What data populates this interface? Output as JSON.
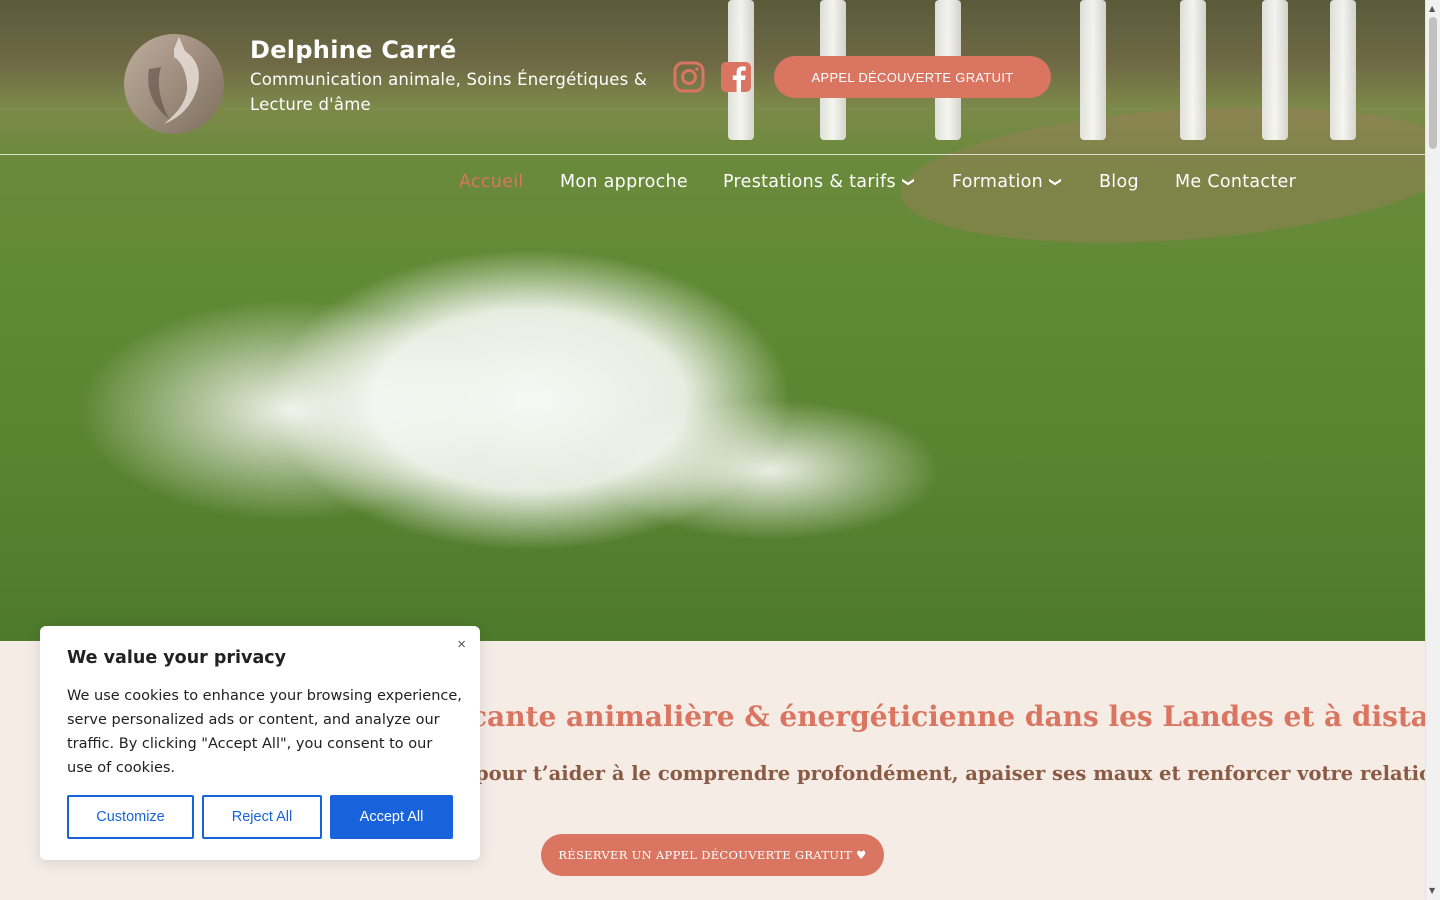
{
  "brand": {
    "name": "Delphine Carré",
    "tagline": "Communication animale, Soins Énergétiques & Lecture d'âme",
    "accent_color": "#d97560",
    "logo_icon": "cat-moon-logo"
  },
  "header": {
    "social": [
      {
        "name": "instagram-icon"
      },
      {
        "name": "facebook-icon"
      }
    ],
    "cta_label": "APPEL DÉCOUVERTE GRATUIT"
  },
  "nav": {
    "items": [
      {
        "label": "Accueil",
        "active": true
      },
      {
        "label": "Mon approche"
      },
      {
        "label": "Prestations & tarifs",
        "dropdown": true
      },
      {
        "label": "Formation",
        "dropdown": true
      },
      {
        "label": "Blog"
      },
      {
        "label": "Me Contacter"
      }
    ]
  },
  "content": {
    "headline_visible": "cante animalière & énergéticienne dans les Landes et à distance",
    "subline_visible": "pour t’aider à le comprendre profondément, apaiser ses maux et renforcer votre relation.",
    "cta_label": "RÉSERVER UN APPEL DÉCOUVERTE GRATUIT ♥"
  },
  "cookie_banner": {
    "title": "We value your privacy",
    "body": "We use cookies to enhance your browsing experience, serve personalized ads or content, and analyze our traffic. By clicking \"Accept All\", you consent to our use of cookies.",
    "close_icon": "×",
    "customize_label": "Customize",
    "reject_label": "Reject All",
    "accept_label": "Accept All",
    "button_color": "#1863dc"
  }
}
